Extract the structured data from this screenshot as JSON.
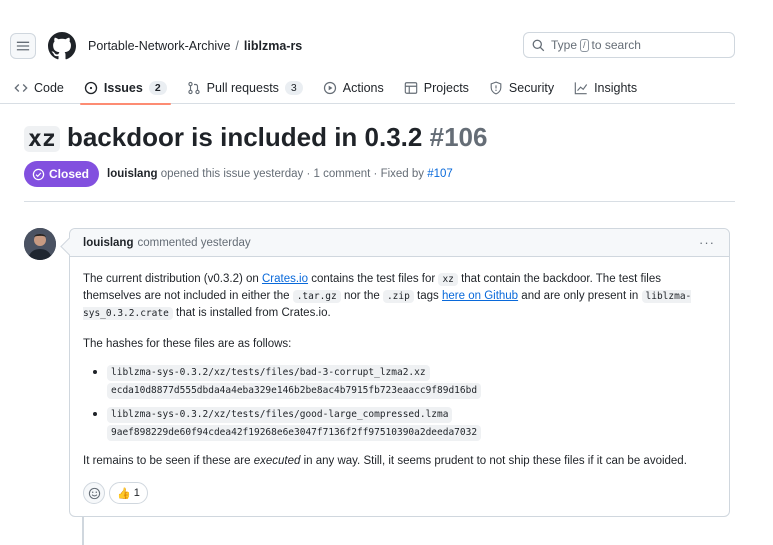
{
  "header": {
    "owner": "Portable-Network-Archive",
    "separator": "/",
    "repo": "liblzma-rs",
    "search_prefix": "Type",
    "search_key": "/",
    "search_suffix": "to search"
  },
  "tabs": [
    {
      "label": "Code"
    },
    {
      "label": "Issues",
      "count": "2"
    },
    {
      "label": "Pull requests",
      "count": "3"
    },
    {
      "label": "Actions"
    },
    {
      "label": "Projects"
    },
    {
      "label": "Security"
    },
    {
      "label": "Insights"
    }
  ],
  "issue": {
    "title_code": "xz",
    "title_text": "backdoor is included in 0.3.2",
    "number": "#106",
    "state": "Closed",
    "author": "louislang",
    "meta_text": "opened this issue yesterday · 1 comment · Fixed by",
    "fixed_by": "#107"
  },
  "comment": {
    "author": "louislang",
    "time_text": "commented yesterday",
    "menu": "···",
    "p1": {
      "t1": "The current distribution (v0.3.2) on",
      "link1": "Crates.io",
      "t2": "contains the test files for",
      "code1": "xz",
      "t3": "that contain the backdoor. The test files themselves are not included in either the",
      "code2": ".tar.gz",
      "t4": "nor the",
      "code3": ".zip",
      "t5": "tags",
      "link2": "here on Github",
      "t6": "and are only present in",
      "code4": "liblzma-sys_0.3.2.crate",
      "t7": "that is installed from Crates.io."
    },
    "p2": "The hashes for these files are as follows:",
    "files": [
      {
        "path": "liblzma-sys-0.3.2/xz/tests/files/bad-3-corrupt_lzma2.xz",
        "hash": "ecda10d8877d555dbda4a4eba329e146b2be8ac4b7915fb723eaacc9f89d16bd"
      },
      {
        "path": "liblzma-sys-0.3.2/xz/tests/files/good-large_compressed.lzma",
        "hash": "9aef898229de60f94cdea42f19268e6e3047f7136f2ff97510390a2deeda7032"
      }
    ],
    "p3_a": "It remains to be seen if these are",
    "p3_em": "executed",
    "p3_b": "in any way. Still, it seems prudent to not ship these files if it can be avoided.",
    "reaction_emoji": "👍",
    "reaction_count": "1"
  },
  "colors": {
    "closed_purple": "#8250df",
    "link_blue": "#0969da",
    "tab_underline": "#fd8c73"
  }
}
